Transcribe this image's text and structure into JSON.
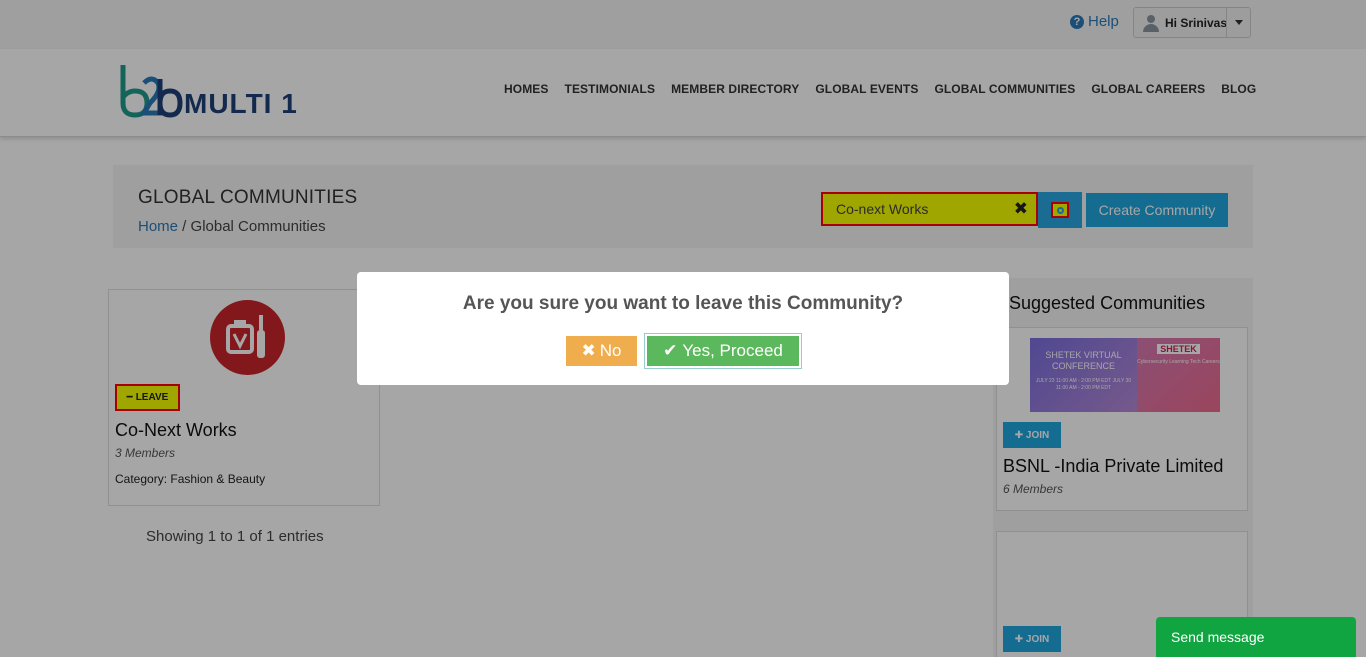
{
  "topbar": {
    "help_label": "Help",
    "user_label": "Hi Srinivas"
  },
  "header": {
    "logo_text": "MULTI 1",
    "nav": [
      "HOMES",
      "TESTIMONIALS",
      "MEMBER DIRECTORY",
      "GLOBAL EVENTS",
      "GLOBAL COMMUNITIES",
      "GLOBAL CAREERS",
      "BLOG"
    ]
  },
  "banner": {
    "title": "GLOBAL COMMUNITIES",
    "breadcrumb_home": "Home",
    "breadcrumb_sep": " / ",
    "breadcrumb_current": "Global Communities",
    "search_value": "Co-next Works",
    "create_label": "Create Community"
  },
  "community": {
    "leave_label": "LEAVE",
    "name": "Co-Next Works",
    "members": "3 Members",
    "category": "Category: Fashion & Beauty"
  },
  "pagination": {
    "showing": "Showing 1 to 1 of 1 entries"
  },
  "suggested": {
    "title": "Suggested Communities",
    "items": [
      {
        "join_label": "JOIN",
        "name": "BSNL -India Private Limited",
        "members": "6 Members",
        "promo_left_title": "SHETEK VIRTUAL CONFERENCE",
        "promo_left_dates": "JULY 23 11:00 AM - 2:00 PM EDT JULY 30 11:00 AM - 2:00 PM EDT",
        "promo_brand": "SHETEK",
        "promo_right_text": "Cybersecurity Learning Tech Careers"
      },
      {
        "join_label": "JOIN"
      }
    ]
  },
  "modal": {
    "question": "Are you sure you want to leave this Community?",
    "no_label": "No",
    "yes_label": "Yes, Proceed"
  },
  "chat": {
    "label": "Send message"
  },
  "colors": {
    "accent_blue": "#1fa7dd",
    "leave_red": "#c9252c",
    "confirm_green": "#5cb85c",
    "cancel_orange": "#f0ad4e",
    "highlight_yellow": "#f5ff00"
  }
}
